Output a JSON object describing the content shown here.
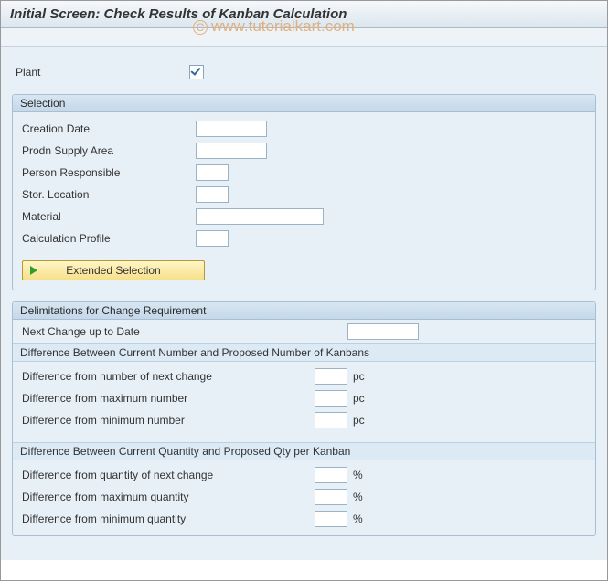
{
  "header": {
    "title": "Initial Screen: Check Results of Kanban Calculation"
  },
  "watermark": "www.tutorialkart.com",
  "plant": {
    "label": "Plant",
    "checked": true
  },
  "selection": {
    "title": "Selection",
    "fields": {
      "creation_date": {
        "label": "Creation Date",
        "value": ""
      },
      "prodn_supply_area": {
        "label": "Prodn Supply Area",
        "value": ""
      },
      "person_responsible": {
        "label": "Person Responsible",
        "value": ""
      },
      "stor_location": {
        "label": "Stor. Location",
        "value": ""
      },
      "material": {
        "label": "Material",
        "value": ""
      },
      "calculation_profile": {
        "label": "Calculation Profile",
        "value": ""
      }
    },
    "extended_button": "Extended Selection"
  },
  "delimitations": {
    "title": "Delimitations for Change Requirement",
    "next_change": {
      "label": "Next Change up to Date",
      "value": ""
    },
    "num_section": {
      "title": "Difference Between Current Number and Proposed Number of Kanbans",
      "rows": [
        {
          "label": "Difference from number of next change",
          "value": "",
          "unit": "pc"
        },
        {
          "label": "Difference from maximum number",
          "value": "",
          "unit": "pc"
        },
        {
          "label": "Difference from minimum number",
          "value": "",
          "unit": "pc"
        }
      ]
    },
    "qty_section": {
      "title": "Difference Between Current Quantity and Proposed Qty per Kanban",
      "rows": [
        {
          "label": "Difference from quantity of next change",
          "value": "",
          "unit": "%"
        },
        {
          "label": "Difference from maximum quantity",
          "value": "",
          "unit": "%"
        },
        {
          "label": "Difference from minimum quantity",
          "value": "",
          "unit": "%"
        }
      ]
    }
  }
}
